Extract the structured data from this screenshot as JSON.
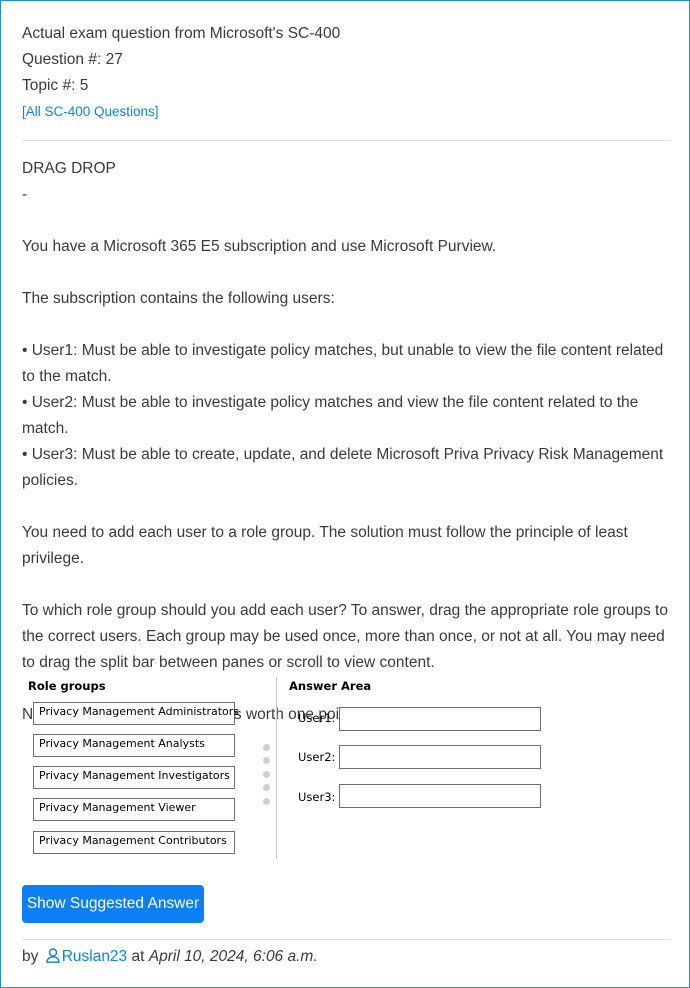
{
  "header": {
    "line1": "Actual exam question from Microsoft's SC-400",
    "question_no": "Question #: 27",
    "topic_no": "Topic #: 5",
    "all_questions_link": "[All SC-400 Questions]"
  },
  "question": {
    "type": "DRAG DROP",
    "dash": "-",
    "p1": "You have a Microsoft 365 E5 subscription and use Microsoft Purview.",
    "p2": "The subscription contains the following users:",
    "bullets": [
      "• User1: Must be able to investigate policy matches, but unable to view the file content related to the match.",
      "• User2: Must be able to investigate policy matches and view the file content related to the match.",
      "• User3: Must be able to create, update, and delete Microsoft Priva Privacy Risk Management policies."
    ],
    "p3": "You need to add each user to a role group. The solution must follow the principle of least privilege.",
    "p4": "To which role group should you add each user? To answer, drag the appropriate role groups to the correct users. Each group may be used once, more than once, or not at all. You may need to drag the split bar between panes or scroll to view content.",
    "p5": "NOTE: Each correct selection is worth one point."
  },
  "drag_drop": {
    "role_groups_title": "Role groups",
    "role_groups": [
      "Privacy Management Administrators",
      "Privacy Management Analysts",
      "Privacy Management Investigators",
      "Privacy Management Viewer",
      "Privacy Management Contributors"
    ],
    "answer_area_title": "Answer Area",
    "users": [
      "User1:",
      "User2:",
      "User3:"
    ]
  },
  "show_answer_button": "Show Suggested Answer",
  "footer": {
    "by": "by",
    "username": "Ruslan23",
    "at": "at",
    "date": "April 10, 2024, 6:06 a.m."
  },
  "colors": {
    "accent": "#0a84d8",
    "button": "#0d7ff5",
    "border": "#1a8fd8"
  },
  "icons": {
    "user": "user-outline-icon"
  }
}
